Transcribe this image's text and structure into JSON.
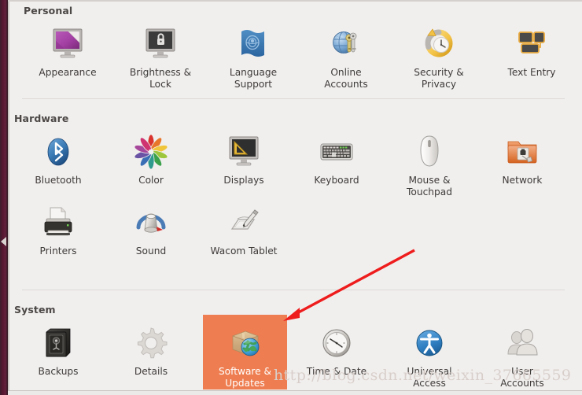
{
  "window": {
    "background_color": "#f1efee",
    "launcher_color": "#57162f",
    "accent_color": "#ee7e51",
    "annotation_color": "#ee1c1c"
  },
  "sections": [
    {
      "id": "personal",
      "title": "Personal",
      "items": [
        {
          "label": "Appearance",
          "icon": "appearance-icon"
        },
        {
          "label": "Brightness &\nLock",
          "icon": "brightness-lock-icon"
        },
        {
          "label": "Language\nSupport",
          "icon": "language-support-icon"
        },
        {
          "label": "Online\nAccounts",
          "icon": "online-accounts-icon"
        },
        {
          "label": "Security &\nPrivacy",
          "icon": "security-privacy-icon"
        },
        {
          "label": "Text Entry",
          "icon": "text-entry-icon"
        }
      ]
    },
    {
      "id": "hardware",
      "title": "Hardware",
      "items": [
        {
          "label": "Bluetooth",
          "icon": "bluetooth-icon"
        },
        {
          "label": "Color",
          "icon": "color-icon"
        },
        {
          "label": "Displays",
          "icon": "displays-icon"
        },
        {
          "label": "Keyboard",
          "icon": "keyboard-icon"
        },
        {
          "label": "Mouse &\nTouchpad",
          "icon": "mouse-touchpad-icon"
        },
        {
          "label": "Network",
          "icon": "network-icon"
        },
        {
          "label": "Printers",
          "icon": "printers-icon"
        },
        {
          "label": "Sound",
          "icon": "sound-icon"
        },
        {
          "label": "Wacom Tablet",
          "icon": "wacom-tablet-icon"
        }
      ]
    },
    {
      "id": "system",
      "title": "System",
      "items": [
        {
          "label": "Backups",
          "icon": "backups-icon"
        },
        {
          "label": "Details",
          "icon": "details-icon"
        },
        {
          "label": "Software &\nUpdates",
          "icon": "software-updates-icon",
          "selected": true
        },
        {
          "label": "Time & Date",
          "icon": "time-date-icon"
        },
        {
          "label": "Universal\nAccess",
          "icon": "universal-access-icon"
        },
        {
          "label": "User\nAccounts",
          "icon": "user-accounts-icon"
        }
      ]
    }
  ],
  "watermark": {
    "text": "http://blog.csdn.net/weixin_37665559"
  }
}
